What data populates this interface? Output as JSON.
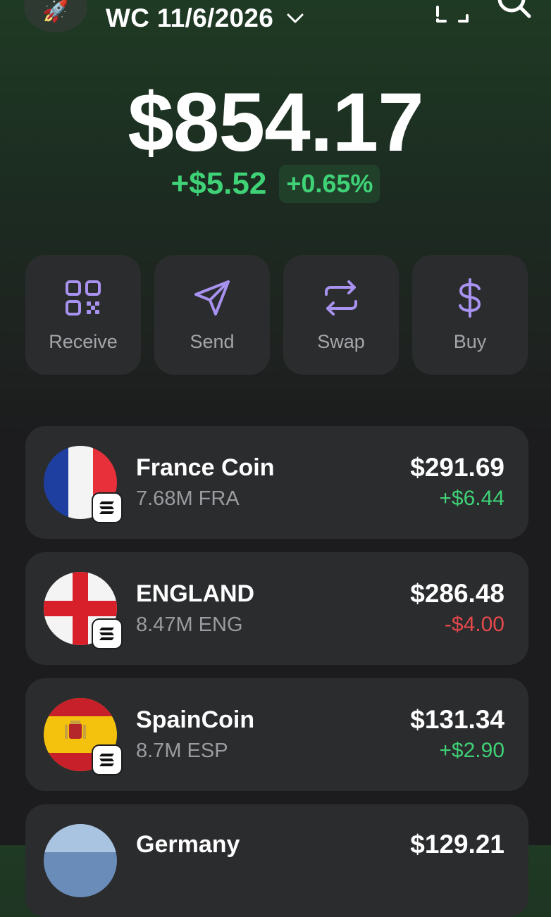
{
  "header": {
    "avatar_emoji": "🚀",
    "account_name": "WC 11/6/2026",
    "icons": [
      "chevron-down-icon",
      "scan-icon",
      "search-icon"
    ]
  },
  "portfolio": {
    "balance": "$854.17",
    "change_abs": "+$5.52",
    "change_pct": "+0.65%"
  },
  "actions": [
    {
      "label": "Receive",
      "icon": "qr-code-icon"
    },
    {
      "label": "Send",
      "icon": "send-icon"
    },
    {
      "label": "Swap",
      "icon": "swap-icon"
    },
    {
      "label": "Buy",
      "icon": "dollar-icon"
    }
  ],
  "tokens": [
    {
      "name": "France Coin",
      "amount": "7.68M FRA",
      "value": "$291.69",
      "change": "+$6.44",
      "direction": "up",
      "flag": "france"
    },
    {
      "name": "ENGLAND",
      "amount": "8.47M ENG",
      "value": "$286.48",
      "change": "-$4.00",
      "direction": "down",
      "flag": "england"
    },
    {
      "name": "SpainCoin",
      "amount": "8.7M ESP",
      "value": "$131.34",
      "change": "+$2.90",
      "direction": "up",
      "flag": "spain"
    },
    {
      "name": "Germany",
      "amount": "",
      "value": "$129.21",
      "change": "",
      "direction": "up",
      "flag": "germany"
    }
  ],
  "colors": {
    "accent": "#a892f0",
    "positive": "#3fd277",
    "negative": "#e4494c",
    "card": "#2b2c2e"
  }
}
